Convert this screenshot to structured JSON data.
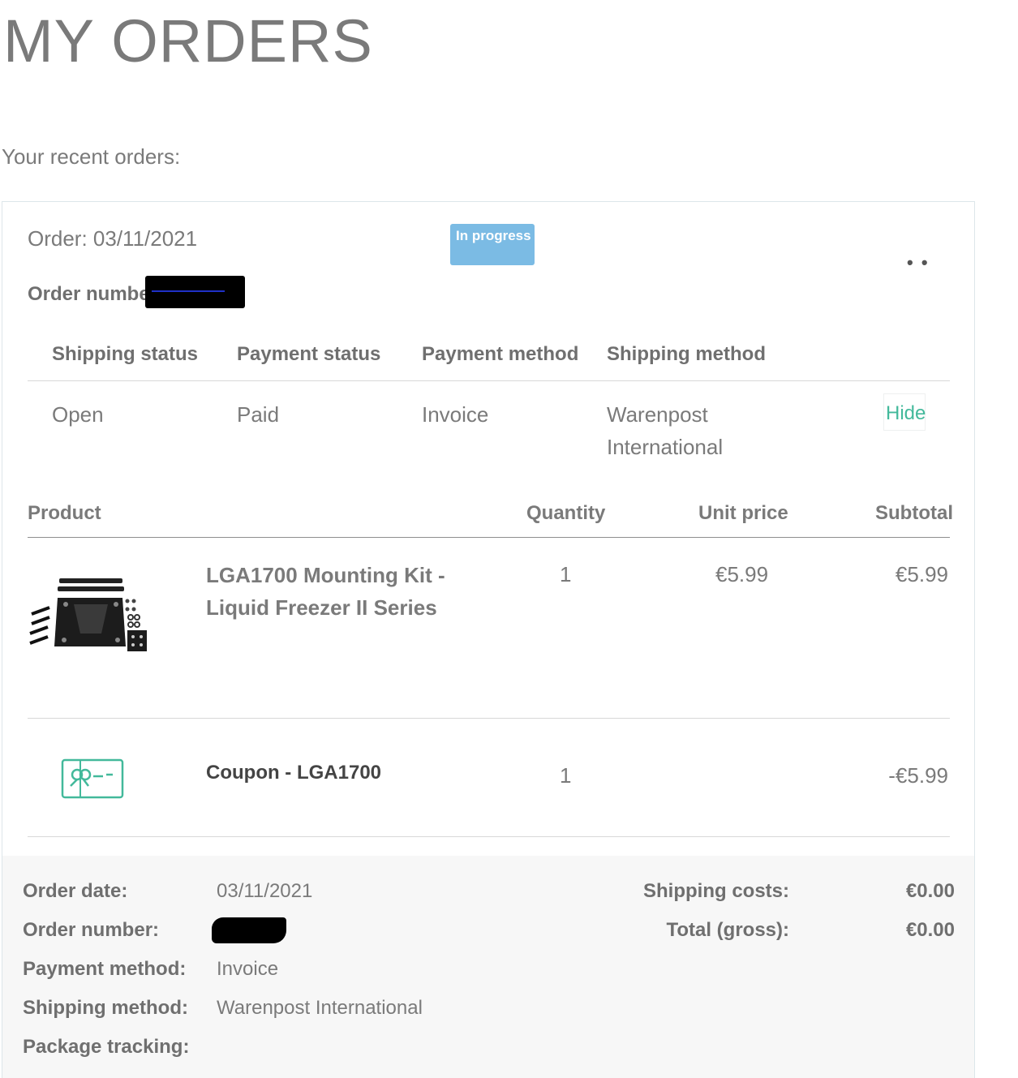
{
  "page": {
    "title": "MY ORDERS",
    "recent_label": "Your recent orders:"
  },
  "order": {
    "date_line": "Order: 03/11/2021",
    "status_badge": "In progress",
    "number_label": "Order numbe",
    "more_icon": "more-dots-icon",
    "info_headers": [
      "Shipping status",
      "Payment status",
      "Payment method",
      "Shipping method"
    ],
    "info_values": {
      "shipping_status": "Open",
      "payment_status": "Paid",
      "payment_method": "Invoice",
      "shipping_method_line1": "Warenpost",
      "shipping_method_line2": "International"
    },
    "hide_label": "Hide",
    "table_headers": {
      "product": "Product",
      "quantity": "Quantity",
      "unit_price": "Unit price",
      "subtotal": "Subtotal"
    },
    "items": [
      {
        "name": "LGA1700 Mounting Kit - Liquid Freezer II Series",
        "quantity": "1",
        "unit_price": "€5.99",
        "subtotal": "€5.99",
        "image": "mounting-kit-image"
      },
      {
        "name": "Coupon - LGA1700",
        "quantity": "1",
        "unit_price": "",
        "subtotal": "-€5.99",
        "image": "coupon-icon"
      }
    ],
    "summary": {
      "order_date_label": "Order date:",
      "order_date_value": "03/11/2021",
      "order_number_label": "Order number:",
      "payment_method_label": "Payment method:",
      "payment_method_value": "Invoice",
      "shipping_method_label": "Shipping method:",
      "shipping_method_value": "Warenpost International",
      "package_tracking_label": "Package tracking:",
      "shipping_costs_label": "Shipping costs:",
      "shipping_costs_value": "€0.00",
      "total_label": "Total (gross):",
      "total_value": "€0.00"
    }
  },
  "colors": {
    "badge": "#7bbbe4",
    "accent_green": "#43b99b",
    "footer_bg": "#f7f7f7"
  }
}
